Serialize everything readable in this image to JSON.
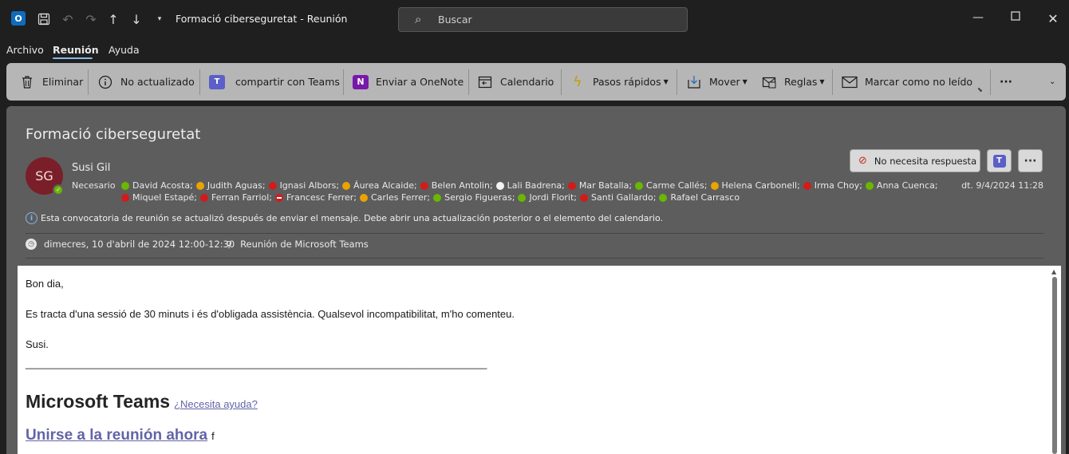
{
  "titlebar": {
    "app_icon": "outlook-icon",
    "app_letter": "O",
    "title": "Formació ciberseguretat  -  Reunión",
    "search_placeholder": "Buscar"
  },
  "menu": {
    "items": [
      "Archivo",
      "Reunión",
      "Ayuda"
    ],
    "active": "Reunión"
  },
  "ribbon": {
    "delete": "Eliminar",
    "not_updated": "No actualizado",
    "share_teams": "compartir con Teams",
    "send_onenote": "Enviar a OneNote",
    "calendar": "Calendario",
    "quick_steps": "Pasos rápidos",
    "move": "Mover",
    "rules": "Reglas",
    "mark_unread": "Marcar como no leído",
    "more": "···"
  },
  "message": {
    "subject": "Formació ciberseguretat",
    "avatar_initials": "SG",
    "sender": "Susi Gil",
    "required_label": "Necesario",
    "received": "dt. 9/4/2024 11:28",
    "no_response_label": "No necesita respuesta",
    "info": "Esta convocatoria de reunión se actualizó después de enviar el mensaje. Debe abrir una actualización posterior o el elemento del calendario.",
    "when": "dimecres, 10 d'abril de 2024 12:00-12:30",
    "where": "Reunión de Microsoft Teams",
    "attendees_line1": [
      {
        "name": "David Acosta;",
        "status": "ok"
      },
      {
        "name": "Judith Aguas;",
        "status": "tent"
      },
      {
        "name": "Ignasi Albors;",
        "status": "busy"
      },
      {
        "name": "Áurea Alcaide;",
        "status": "tent"
      },
      {
        "name": "Belen Antolin;",
        "status": "busy"
      },
      {
        "name": "Lali Badrena;",
        "status": "none"
      },
      {
        "name": "Mar Batalla;",
        "status": "busy"
      },
      {
        "name": "Carme Callés;",
        "status": "ok"
      },
      {
        "name": "Helena Carbonell;",
        "status": "tent"
      },
      {
        "name": "Irma Choy;",
        "status": "busy"
      },
      {
        "name": "Anna Cuenca;",
        "status": "ok"
      }
    ],
    "attendees_line2": [
      {
        "name": "Miquel Estapé;",
        "status": "busy"
      },
      {
        "name": "Ferran Farriol;",
        "status": "busy"
      },
      {
        "name": "Francesc Ferrer;",
        "status": "dec"
      },
      {
        "name": "Carles Ferrer;",
        "status": "tent"
      },
      {
        "name": "Sergio Figueras;",
        "status": "ok"
      },
      {
        "name": "Jordi Florit;",
        "status": "ok"
      },
      {
        "name": "Santi Gallardo;",
        "status": "busy"
      },
      {
        "name": "Rafael Carrasco",
        "status": "ok"
      }
    ]
  },
  "body": {
    "greeting": "Bon dia,",
    "paragraph": "Es tracta d'una sessió de 30 minuts i és d'obligada assistència. Qualsevol incompatibilitat, m'ho comenteu.",
    "signature": "Susi.",
    "rule": "________________________________________________________________________________",
    "teams_title": "Microsoft Teams",
    "help_link": "¿Necesita ayuda?",
    "join_link": "Unirse a la reunión ahora",
    "join_tail": "f"
  },
  "colors": {
    "ribbon_bg": "#b6b6b6",
    "header_bg": "#5d5d5d",
    "teams_purple": "#6264a7",
    "avatar_bg": "#7a1f2a"
  }
}
